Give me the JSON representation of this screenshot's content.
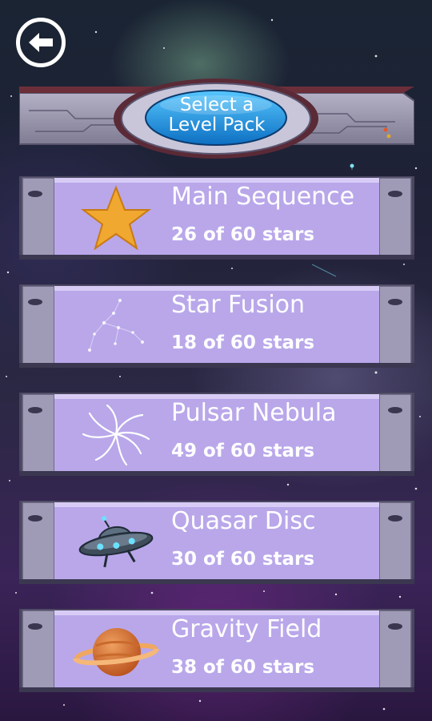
{
  "header": {
    "title_line1": "Select a",
    "title_line2": "Level Pack"
  },
  "back_button": {
    "icon": "arrow-left-icon"
  },
  "packs": [
    {
      "name": "Main Sequence",
      "progress": "26 of 60 stars",
      "icon": "star-icon"
    },
    {
      "name": "Star Fusion",
      "progress": "18 of 60 stars",
      "icon": "constellation-icon"
    },
    {
      "name": "Pulsar Nebula",
      "progress": "49 of 60 stars",
      "icon": "spiral-icon"
    },
    {
      "name": "Quasar Disc",
      "progress": "30 of 60 stars",
      "icon": "ufo-icon"
    },
    {
      "name": "Gravity Field",
      "progress": "38 of 60 stars",
      "icon": "planet-icon"
    }
  ],
  "colors": {
    "panel_purple": "#b9a7ea",
    "frame_grey": "#8f8ca3",
    "lens_blue": "#1e8fd8"
  }
}
